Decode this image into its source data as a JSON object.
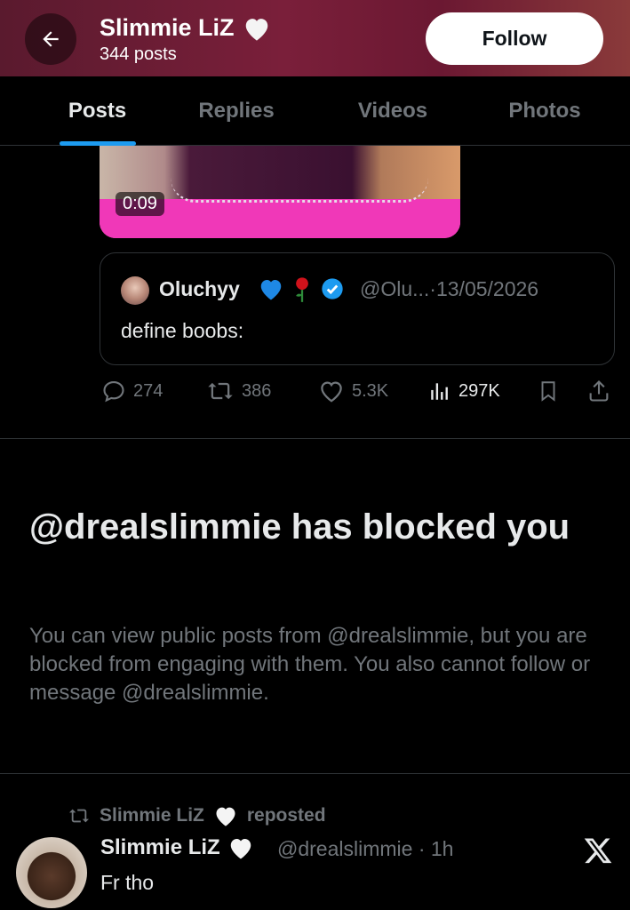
{
  "header": {
    "name": "Slimmie LiZ",
    "posts": "344 posts",
    "follow_label": "Follow"
  },
  "tabs": [
    {
      "label": "Posts",
      "active": true
    },
    {
      "label": "Replies",
      "active": false
    },
    {
      "label": "Videos",
      "active": false
    },
    {
      "label": "Photos",
      "active": false
    }
  ],
  "video": {
    "duration": "0:09"
  },
  "quote": {
    "name": "Oluchyy",
    "handle_date": "@Olu...·13/05/2026",
    "text": "define boobs:"
  },
  "actions": {
    "replies": "274",
    "reposts": "386",
    "likes": "5.3K",
    "views": "297K"
  },
  "blocked": {
    "title": "@drealslimmie has blocked you",
    "description": "You can view public posts from @drealslimmie, but you are blocked from engaging with them. You also cannot follow or message @drealslimmie."
  },
  "repost": {
    "reposter": "Slimmie LiZ",
    "reposted_label": "reposted",
    "author_name": "Slimmie LiZ",
    "handle_time": "@drealslimmie · 1h",
    "text": "Fr tho"
  },
  "colors": {
    "accent": "#1d9bf0",
    "muted": "#71767b",
    "background": "#000000",
    "header_gradient": "#7a1f3a"
  }
}
